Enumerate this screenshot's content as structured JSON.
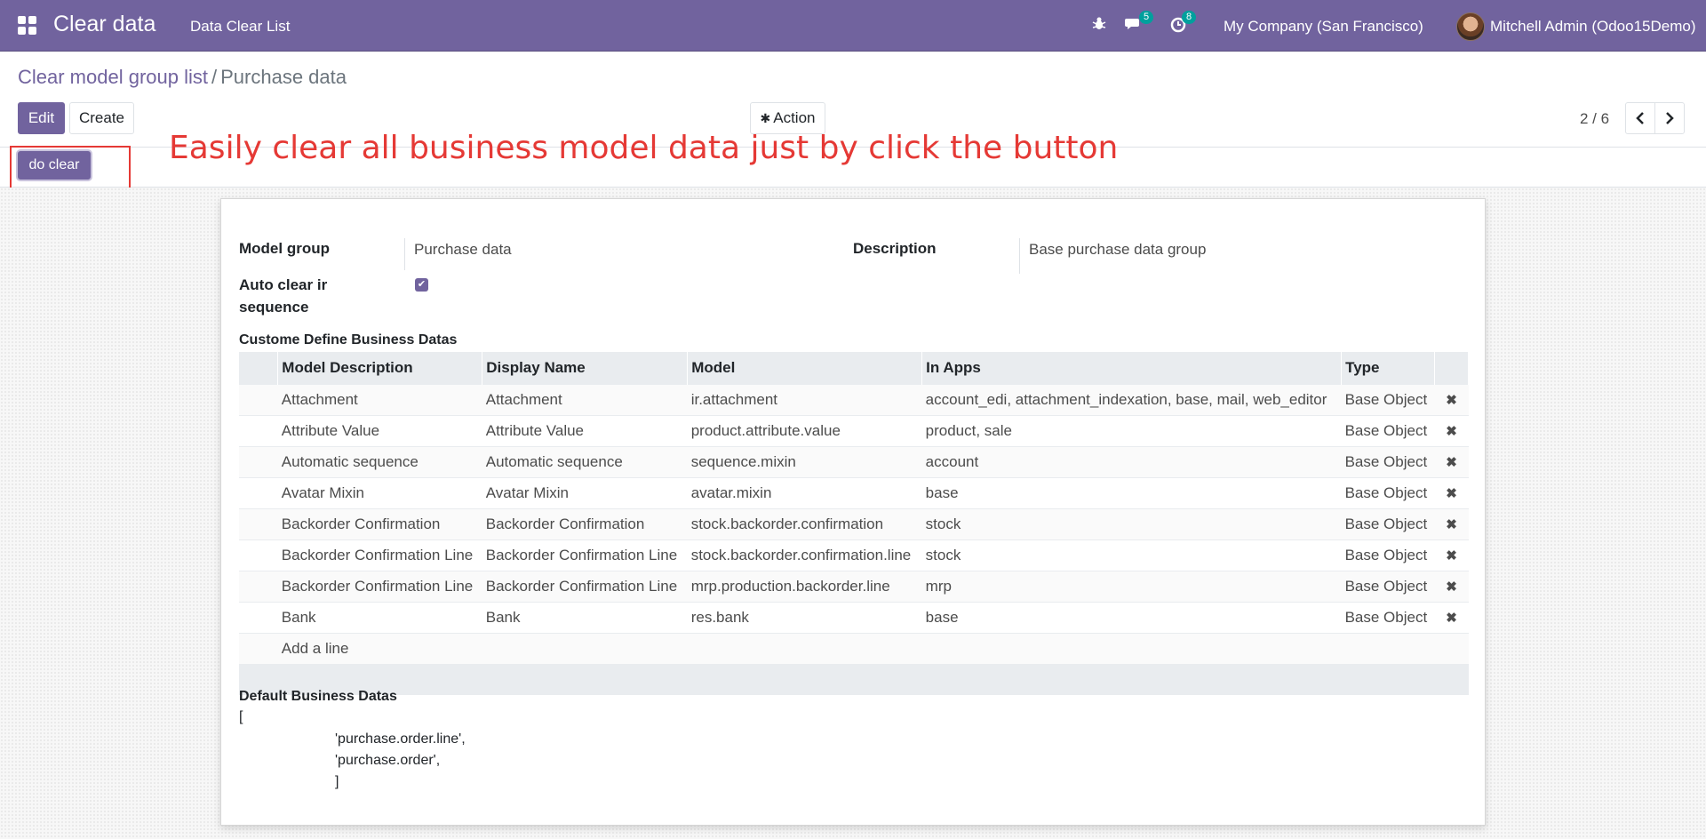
{
  "navbar": {
    "app_title": "Clear data",
    "menu_item": "Data Clear List",
    "discuss_count": "5",
    "activity_count": "8",
    "company": "My Company (San Francisco)",
    "user": "Mitchell Admin (Odoo15Demo)",
    "color": "#71639e"
  },
  "breadcrumb": {
    "parent": "Clear model group list",
    "separator": "/",
    "current": "Purchase data"
  },
  "buttons": {
    "edit": "Edit",
    "create": "Create",
    "action": "Action",
    "do_clear": "do clear"
  },
  "pager": {
    "value": "2 / 6"
  },
  "annotation": "Easily clear all business model data just by click the button",
  "form": {
    "model_group_label": "Model group",
    "model_group_value": "Purchase data",
    "description_label": "Description",
    "description_value": "Base purchase data group",
    "auto_clear_label_1": "Auto clear ir",
    "auto_clear_label_2": "sequence",
    "auto_clear_checked": true,
    "custom_section_title": "Custome Define Business Datas",
    "default_section_title": "Default Business Datas"
  },
  "table": {
    "columns": [
      "Model Description",
      "Display Name",
      "Model",
      "In Apps",
      "Type"
    ],
    "rows": [
      [
        "Attachment",
        "Attachment",
        "ir.attachment",
        "account_edi, attachment_indexation, base, mail, web_editor",
        "Base Object"
      ],
      [
        "Attribute Value",
        "Attribute Value",
        "product.attribute.value",
        "product, sale",
        "Base Object"
      ],
      [
        "Automatic sequence",
        "Automatic sequence",
        "sequence.mixin",
        "account",
        "Base Object"
      ],
      [
        "Avatar Mixin",
        "Avatar Mixin",
        "avatar.mixin",
        "base",
        "Base Object"
      ],
      [
        "Backorder Confirmation",
        "Backorder Confirmation",
        "stock.backorder.confirmation",
        "stock",
        "Base Object"
      ],
      [
        "Backorder Confirmation Line",
        "Backorder Confirmation Line",
        "stock.backorder.confirmation.line",
        "stock",
        "Base Object"
      ],
      [
        "Backorder Confirmation Line",
        "Backorder Confirmation Line",
        "mrp.production.backorder.line",
        "mrp",
        "Base Object"
      ],
      [
        "Bank",
        "Bank",
        "res.bank",
        "base",
        "Base Object"
      ]
    ],
    "add_line": "Add a line"
  },
  "default_data": {
    "open": "[",
    "lines": [
      "'purchase.order.line',",
      "'purchase.order',"
    ],
    "close": "]"
  }
}
